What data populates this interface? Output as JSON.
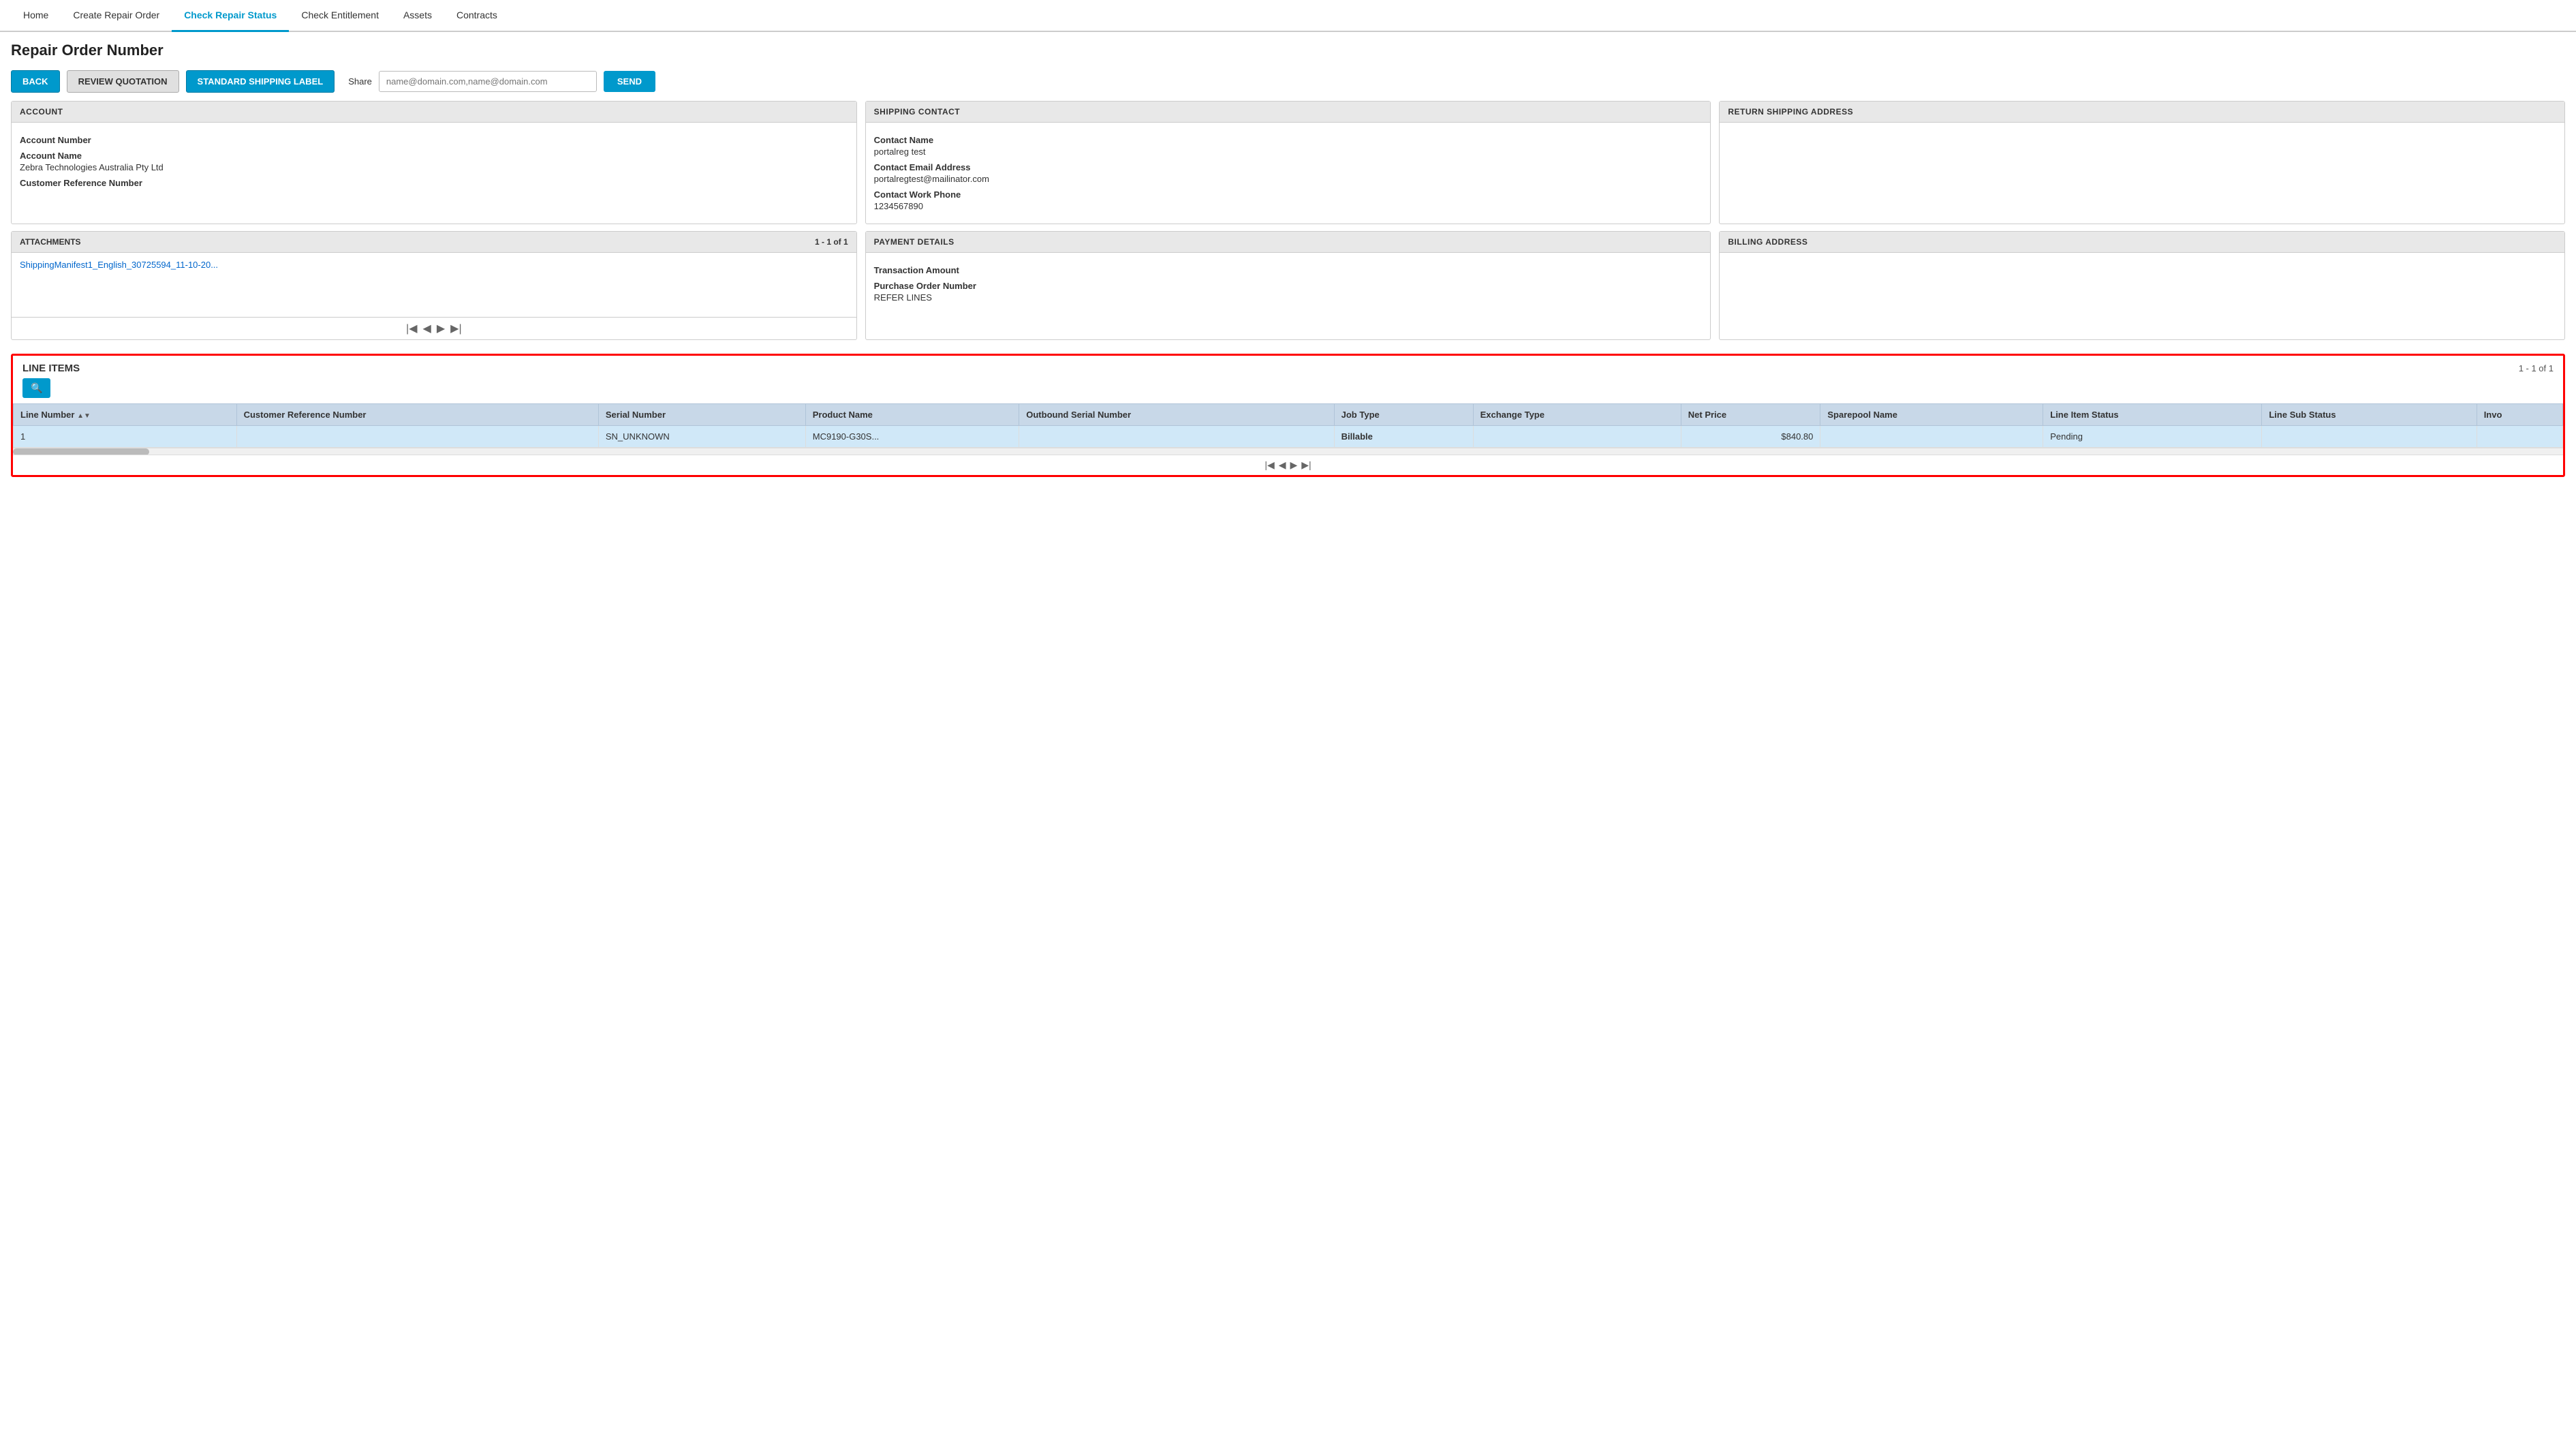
{
  "nav": {
    "items": [
      {
        "label": "Home",
        "active": false
      },
      {
        "label": "Create Repair Order",
        "active": false
      },
      {
        "label": "Check Repair Status",
        "active": true
      },
      {
        "label": "Check Entitlement",
        "active": false
      },
      {
        "label": "Assets",
        "active": false
      },
      {
        "label": "Contracts",
        "active": false
      }
    ]
  },
  "page": {
    "title": "Repair Order Number"
  },
  "toolbar": {
    "back_label": "BACK",
    "review_label": "REVIEW QUOTATION",
    "shipping_label": "STANDARD SHIPPING LABEL",
    "share_label": "Share",
    "share_placeholder": "name@domain.com,name@domain.com",
    "send_label": "SEND"
  },
  "account_panel": {
    "header": "ACCOUNT",
    "fields": [
      {
        "label": "Account Number",
        "value": ""
      },
      {
        "label": "Account Name",
        "value": "Zebra Technologies Australia Pty Ltd"
      },
      {
        "label": "Customer Reference Number",
        "value": ""
      }
    ]
  },
  "shipping_panel": {
    "header": "SHIPPING CONTACT",
    "fields": [
      {
        "label": "Contact Name",
        "value": "portalreg test"
      },
      {
        "label": "Contact Email Address",
        "value": "portalregtest@mailinator.com"
      },
      {
        "label": "Contact Work Phone",
        "value": "1234567890"
      }
    ]
  },
  "return_panel": {
    "header": "RETURN SHIPPING ADDRESS",
    "fields": []
  },
  "attachments_panel": {
    "header": "ATTACHMENTS",
    "count": "1 - 1 of 1",
    "link_text": "ShippingManifest1_English_30725594_11-10-20..."
  },
  "payment_panel": {
    "header": "PAYMENT DETAILS",
    "fields": [
      {
        "label": "Transaction Amount",
        "value": ""
      },
      {
        "label": "Purchase Order Number",
        "value": "REFER LINES"
      }
    ]
  },
  "billing_panel": {
    "header": "BILLING ADDRESS",
    "fields": []
  },
  "line_items": {
    "title": "LINE ITEMS",
    "count": "1 - 1 of 1",
    "columns": [
      "Line Number",
      "Customer Reference Number",
      "Serial Number",
      "Product Name",
      "Outbound Serial Number",
      "Job Type",
      "Exchange Type",
      "Net Price",
      "Sparepool Name",
      "Line Item Status",
      "Line Sub Status",
      "Invo"
    ],
    "rows": [
      {
        "line_number": "1",
        "customer_ref": "",
        "serial_number": "SN_UNKNOWN",
        "product_name": "MC9190-G30S...",
        "outbound_serial": "",
        "job_type": "Billable",
        "exchange_type": "",
        "net_price": "$840.80",
        "sparepool_name": "",
        "line_item_status": "Pending",
        "line_sub_status": "",
        "invoice": ""
      }
    ]
  }
}
